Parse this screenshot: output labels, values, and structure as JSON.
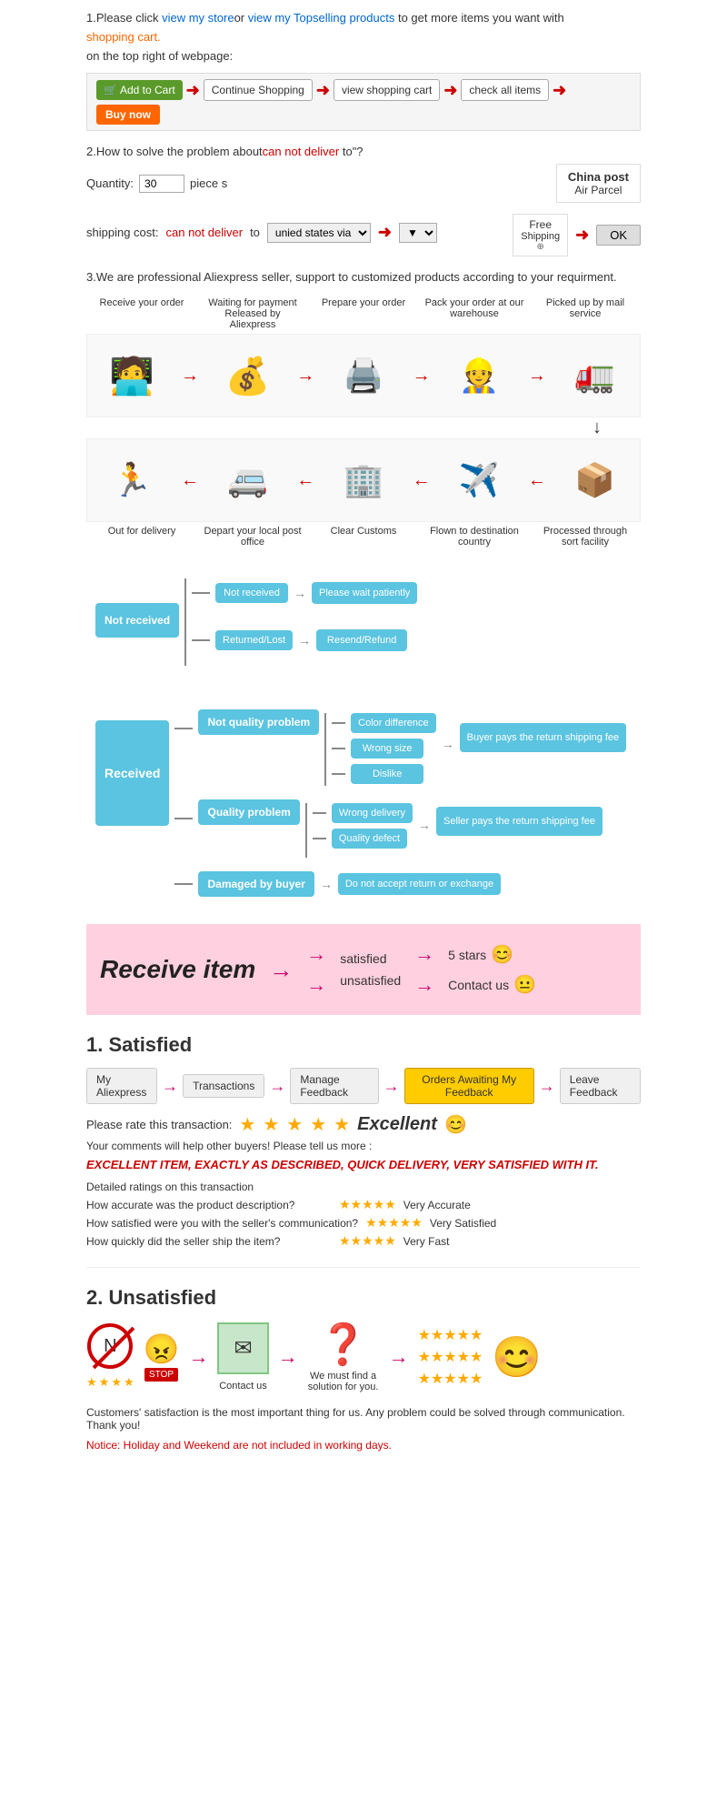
{
  "section1": {
    "text1": "1.Please click ",
    "link1": "view my store",
    "text2": "or ",
    "link2": "view my Topselling products",
    "text3": " to get more items you want with",
    "text4": "shopping cart.",
    "text5": "on the top right of webpage:",
    "btn_add": "Add to Cart",
    "btn_continue": "Continue Shopping",
    "btn_view": "view shopping cart",
    "btn_check": "check all items",
    "btn_buy": "Buy now"
  },
  "section2": {
    "title": "2.How to solve the problem about",
    "highlight": "can not deliver",
    "title2": " to\"?",
    "quantity_label": "Quantity:",
    "quantity_value": "30",
    "quantity_unit": "piece s",
    "shipping_label": "shipping cost:",
    "shipping_highlight": "can not deliver",
    "shipping_text": " to ",
    "shipping_select": "unied states via",
    "china_post_title": "China post",
    "china_post_sub": "Air Parcel",
    "free_shipping": "Free",
    "shipping_word": "Shipping",
    "ok_btn": "OK"
  },
  "section3": {
    "text": "3.We are professional Aliexpress seller, support to customized products according to your requirment."
  },
  "process": {
    "top_labels": [
      "Receive your order",
      "Waiting for payment Released by Aliexpress",
      "Prepare your order",
      "Pack your order at our warehouse",
      "Picked up by mail service"
    ],
    "bottom_labels": [
      "Out for delivery",
      "Depart your local post office",
      "Clear Customs",
      "Flown to destination country",
      "Processed through sort facility"
    ],
    "icons_top": [
      "🧑‍💻",
      "💰",
      "🖨️",
      "👷",
      "🚛"
    ],
    "icons_bottom": [
      "🏃",
      "🚐",
      "🏢",
      "✈️",
      "📦"
    ]
  },
  "not_received": {
    "main_label": "Not received",
    "branch1": "Not received",
    "result1": "Please wait patiently",
    "branch2": "Returned/Lost",
    "result2": "Resend/Refund"
  },
  "received": {
    "main_label": "Received",
    "branch1_label": "Not quality problem",
    "sub1a": "Color difference",
    "sub1b": "Wrong size",
    "sub1c": "Dislike",
    "outcome1": "Buyer pays the return shipping fee",
    "branch2_label": "Quality problem",
    "sub2a": "Wrong delivery",
    "sub2b": "Quality defect",
    "outcome2": "Seller pays the return shipping fee",
    "branch3_label": "Damaged by buyer",
    "result3": "Do not accept return or exchange"
  },
  "pink_section": {
    "title": "Receive item",
    "row1_text": "satisfied",
    "row1_result": "5 stars",
    "row2_text": "unsatisfied",
    "row2_result": "Contact us"
  },
  "satisfied": {
    "title": "1. Satisfied",
    "step1": "My Aliexpress",
    "step2": "Transactions",
    "step3": "Manage Feedback",
    "step4": "Orders Awaiting My Feedback",
    "step5": "Leave Feedback",
    "rate_label": "Please rate this transaction:",
    "excellent": "Excellent",
    "comment_label": "Your comments will help other buyers! Please tell us more :",
    "review": "EXCELLENT ITEM, EXACTLY AS DESCRIBED, QUICK DELIVERY, VERY SATISFIED WITH IT.",
    "detail_title": "Detailed ratings on this transaction",
    "detail1_label": "How accurate was the product description?",
    "detail1_value": "Very Accurate",
    "detail2_label": "How satisfied were you with the seller's communication?",
    "detail2_value": "Very Satisfied",
    "detail3_label": "How quickly did the seller ship the item?",
    "detail3_value": "Very Fast"
  },
  "unsatisfied": {
    "title": "2. Unsatisfied",
    "contact_label": "Contact us",
    "find_label": "We must find a solution for you.",
    "notice": "Customers' satisfaction is the most important thing for us. Any problem could be solved through communication. Thank you!",
    "holiday_notice": "Notice: Holiday and Weekend are not included in working days."
  }
}
